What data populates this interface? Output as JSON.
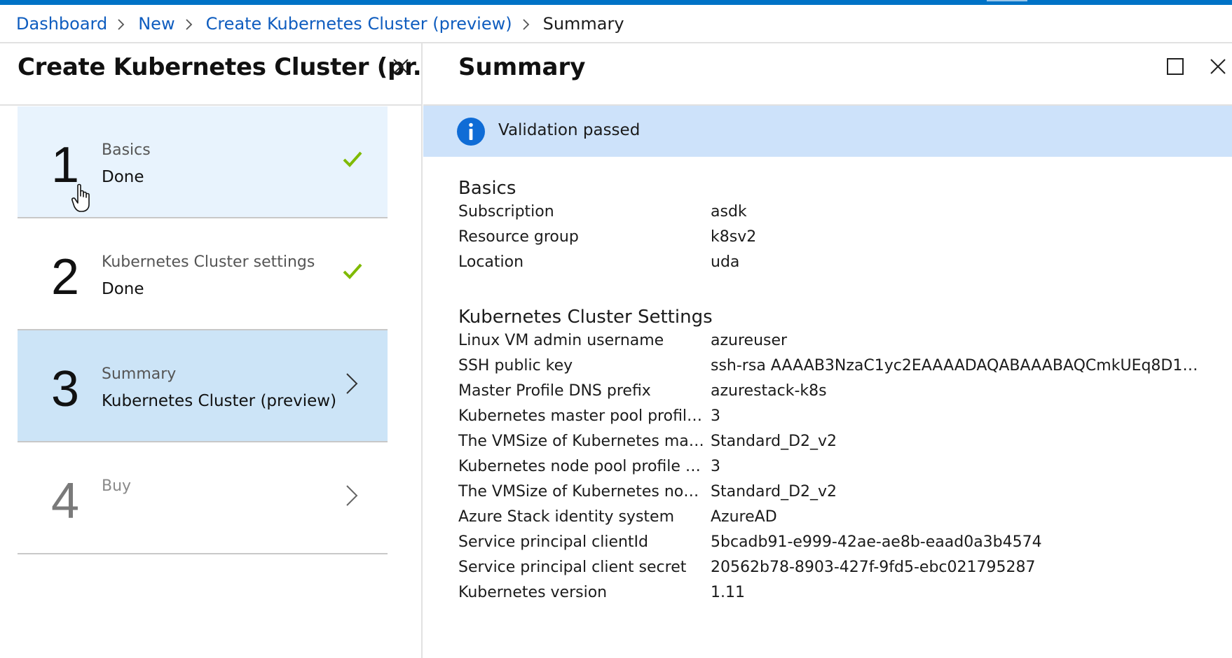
{
  "breadcrumb": {
    "items": [
      "Dashboard",
      "New",
      "Create Kubernetes Cluster (preview)"
    ],
    "current": "Summary"
  },
  "left_blade": {
    "title": "Create Kubernetes Cluster (pr...",
    "steps": [
      {
        "number": "1",
        "title": "Basics",
        "subtitle": "Done",
        "status": "done"
      },
      {
        "number": "2",
        "title": "Kubernetes Cluster settings",
        "subtitle": "Done",
        "status": "done"
      },
      {
        "number": "3",
        "title": "Summary",
        "subtitle": "Kubernetes Cluster (preview)",
        "status": "current"
      },
      {
        "number": "4",
        "title": "Buy",
        "subtitle": "",
        "status": "disabled"
      }
    ]
  },
  "right_blade": {
    "title": "Summary",
    "validation": {
      "message": "Validation passed",
      "icon": "info-icon"
    },
    "basics": {
      "heading": "Basics",
      "rows": [
        {
          "label": "Subscription",
          "value": "asdk"
        },
        {
          "label": "Resource group",
          "value": "k8sv2"
        },
        {
          "label": "Location",
          "value": "uda"
        }
      ]
    },
    "cluster_settings": {
      "heading": "Kubernetes Cluster Settings",
      "rows": [
        {
          "label": "Linux VM admin username",
          "value": "azureuser"
        },
        {
          "label": "SSH public key",
          "value": "ssh-rsa AAAAB3NzaC1yc2EAAAADAQABAAABAQCmkUEq8D1sd..."
        },
        {
          "label": "Master Profile DNS prefix",
          "value": "azurestack-k8s"
        },
        {
          "label": "Kubernetes master pool profile ...",
          "value": "3"
        },
        {
          "label": "The VMSize of Kubernetes mas...",
          "value": "Standard_D2_v2"
        },
        {
          "label": "Kubernetes node pool profile c...",
          "value": "3"
        },
        {
          "label": "The VMSize of Kubernetes nod...",
          "value": "Standard_D2_v2"
        },
        {
          "label": "Azure Stack identity system",
          "value": "AzureAD"
        },
        {
          "label": "Service principal clientId",
          "value": "5bcadb91-e999-42ae-ae8b-eaad0a3b4574"
        },
        {
          "label": "Service principal client secret",
          "value": "20562b78-8903-427f-9fd5-ebc021795287"
        },
        {
          "label": "Kubernetes version",
          "value": "1.11"
        }
      ]
    }
  },
  "colors": {
    "top_bar": "#0072c6",
    "link": "#0f5dbf",
    "check": "#7fba00",
    "validation_bg": "#cde2fa",
    "info_icon": "#0f6cd6",
    "step_done_bg": "#e8f3fd",
    "step_selected_bg": "#cce4f7"
  }
}
